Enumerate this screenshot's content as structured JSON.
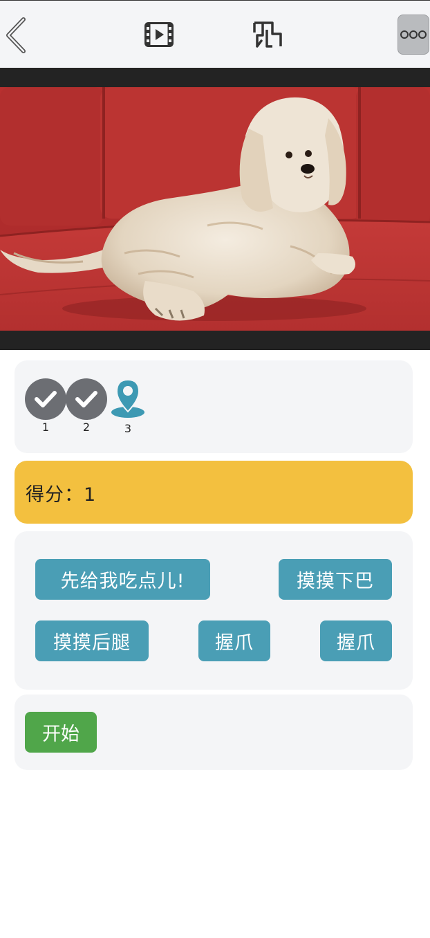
{
  "toolbar": {
    "back_icon": "chevron-left-icon",
    "film_icon": "film-icon",
    "map_icon": "map-location-icon",
    "more_icon": "more-options-icon"
  },
  "video": {
    "content": "dog-on-red-sofa-photo"
  },
  "progress": {
    "steps": [
      {
        "label": "1",
        "state": "done"
      },
      {
        "label": "2",
        "state": "done"
      },
      {
        "label": "3",
        "state": "current"
      }
    ]
  },
  "score": {
    "text": "得分：1"
  },
  "actions": [
    {
      "label": "先给我吃点儿!"
    },
    {
      "label": "摸摸下巴"
    },
    {
      "label": "摸摸后腿"
    },
    {
      "label": "握爪"
    },
    {
      "label": "握爪"
    }
  ],
  "start": {
    "label": "开始"
  },
  "colors": {
    "score_bg": "#f3c03f",
    "action_bg": "#4a9eb5",
    "start_bg": "#50a64a",
    "done_step": "#6c6e73",
    "current_step": "#3d99b3"
  }
}
